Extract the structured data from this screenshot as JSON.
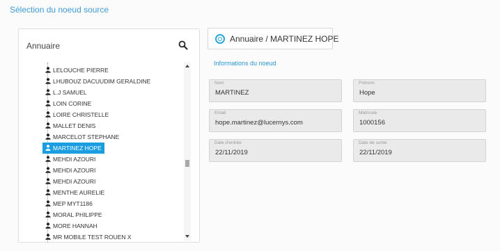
{
  "page": {
    "title": "Sélection du noeud source"
  },
  "tree": {
    "title": "Annuaire",
    "items": [
      "LELOUCHE PIERRE",
      "LHUBOUZ DACUUDIM GERALDINE",
      "L.J SAMUEL",
      "LOIN CORINE",
      "LOIRE CHRISTELLE",
      "MALLET DENIS",
      "MARCELOT STEPHANE",
      "MARTINEZ HOPE",
      "MEHDI AZOURI",
      "MEHDI AZOURI",
      "MEHDI AZOURI",
      "MENTHE AURELIE",
      "MEP MYT1186",
      "MORAL PHILIPPE",
      "MORE HANNAH",
      "MR MOBILE TEST ROUEN X"
    ],
    "selected_index": 7,
    "scroll_fraction": 0.58
  },
  "node": {
    "header": "Annuaire / MARTINEZ HOPE",
    "section_title": "Informations du noeud",
    "fields": {
      "nom": {
        "label": "Nom",
        "value": "MARTINEZ"
      },
      "prenom": {
        "label": "Prénom",
        "value": "Hope"
      },
      "email": {
        "label": "Email",
        "value": "hope.martinez@lucernys.com"
      },
      "matricule": {
        "label": "Matricule",
        "value": "1000156"
      },
      "date_entree": {
        "label": "Date d'entrée",
        "value": "22/11/2019"
      },
      "date_sortie": {
        "label": "Date de sortie",
        "value": "22/11/2019"
      }
    }
  },
  "colors": {
    "accent": "#1a9ee0",
    "link": "#3d9bd6"
  },
  "icons": {
    "search": "search-icon",
    "user": "user-icon",
    "node": "node-circle-icon"
  }
}
